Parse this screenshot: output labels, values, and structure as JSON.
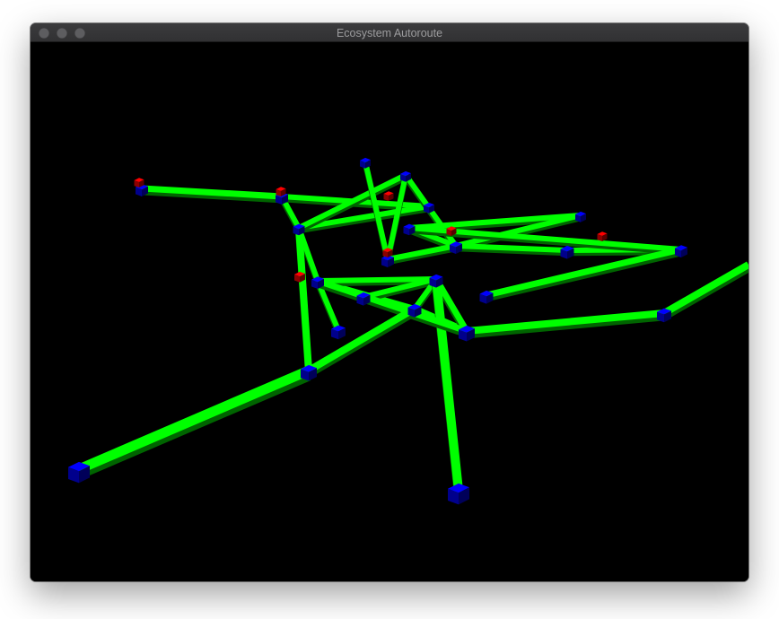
{
  "window": {
    "title": "Ecosystem Autoroute"
  },
  "scene": {
    "background": "#000000",
    "road_color": "#00ff00",
    "road_shadow_color": "#006400",
    "node_color": "#0000ff",
    "marker_color": "#ff0000"
  },
  "icons": {
    "close": "close-icon",
    "minimize": "minimize-icon",
    "zoom": "zoom-icon"
  }
}
